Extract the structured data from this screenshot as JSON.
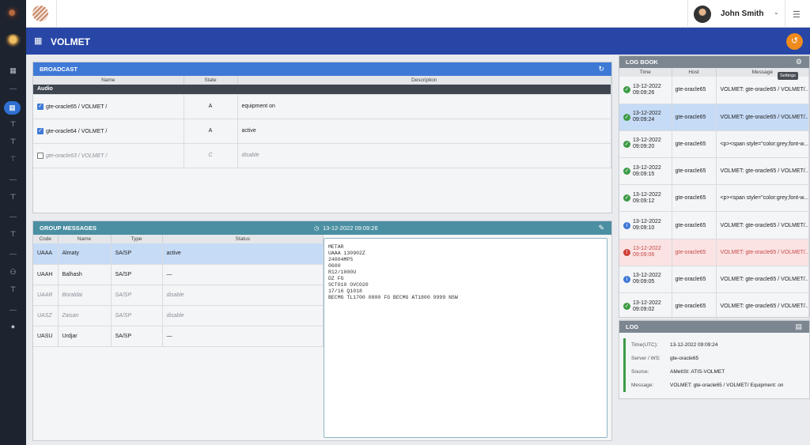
{
  "topbar": {
    "user_name": "John Smith"
  },
  "page": {
    "title": "VOLMET"
  },
  "broadcast": {
    "title": "BROADCAST",
    "columns": [
      "Name",
      "State",
      "Description"
    ],
    "group": "Audio",
    "rows": [
      {
        "name": "gte-oracle65 / VOLMET /",
        "state": "A",
        "description": "equipment on",
        "checked": true
      },
      {
        "name": "gte-oracle64 / VOLMET /",
        "state": "A",
        "description": "active",
        "checked": true
      },
      {
        "name": "gte-oracle63 / VOLMET /",
        "state": "C",
        "description": "disable",
        "checked": false
      }
    ]
  },
  "group_messages": {
    "title": "GROUP MESSAGES",
    "timestamp": "13-12-2022 09:09:26",
    "columns": [
      "Code",
      "Name",
      "Type",
      "Status"
    ],
    "rows": [
      {
        "code": "UAAA",
        "name": "Almaty",
        "type": "SA/SP",
        "status": "active"
      },
      {
        "code": "UAAH",
        "name": "Balhash",
        "type": "SA/SP",
        "status": "—"
      },
      {
        "code": "UAAR",
        "name": "Boraldai",
        "type": "SA/SP",
        "status": "disable"
      },
      {
        "code": "UASZ",
        "name": "Zaisan",
        "type": "SA/SP",
        "status": "disable"
      },
      {
        "code": "UASU",
        "name": "Urdjar",
        "type": "SA/SP",
        "status": "—"
      }
    ],
    "metar_text": "METAR\nUAAA 130902Z\n24004MPS\n0600\nR12/1000U\nDZ FG\nSCT010 OVC020\n17/16 Q1018\nBECMG TL1700 0800 FG BECMG AT1800 9999 NSW"
  },
  "log_book": {
    "title": "LOG BOOK",
    "columns": [
      "Time",
      "Host",
      "Message"
    ],
    "tooltip": "Settings",
    "rows": [
      {
        "status": "ok",
        "date": "13-12-2022",
        "time": "09:09:26",
        "host": "gte-oracle65",
        "message": "VOLMET: gte-oracle65 / VOLMET/..."
      },
      {
        "status": "ok",
        "date": "13-12-2022",
        "time": "09:09:24",
        "host": "gte-oracle65",
        "message": "VOLMET: gte-oracle65 / VOLMET/..."
      },
      {
        "status": "ok",
        "date": "13-12-2022",
        "time": "09:09:20",
        "host": "gte-oracle65",
        "message": "<p><span style=\"color:grey;font-w..."
      },
      {
        "status": "ok",
        "date": "13-12-2022",
        "time": "09:09:15",
        "host": "gte-oracle65",
        "message": "VOLMET: gte-oracle65 / VOLMET/..."
      },
      {
        "status": "ok",
        "date": "13-12-2022",
        "time": "09:09:12",
        "host": "gte-oracle65",
        "message": "<p><span style=\"color:grey;font-w..."
      },
      {
        "status": "info",
        "date": "13-12-2022",
        "time": "09:09:10",
        "host": "gte-oracle65",
        "message": "VOLMET: gte-oracle65 / VOLMET/..."
      },
      {
        "status": "err",
        "date": "13-12-2022",
        "time": "09:09:06",
        "host": "gte-oracle65",
        "message": "VOLMET: gte-oracle65 / VOLMET/..."
      },
      {
        "status": "info",
        "date": "13-12-2022",
        "time": "09:09:05",
        "host": "gte-oracle65",
        "message": "VOLMET: gte-oracle65 / VOLMET/..."
      },
      {
        "status": "ok",
        "date": "13-12-2022",
        "time": "09:09:02",
        "host": "gte-oracle65",
        "message": "VOLMET: gte-oracle65 / VOLMET/..."
      }
    ]
  },
  "log": {
    "title": "LOG",
    "fields": [
      {
        "label": "Time(UTC):",
        "value": "13-12-2022 09:09:24"
      },
      {
        "label": "Server / WS:",
        "value": "gte-oracle65"
      },
      {
        "label": "Source:",
        "value": "AMetISt: ATIS-VOLMET"
      },
      {
        "label": "Message:",
        "value": "VOLMET: gte-oracle65 / VOLMET/ Equipment: on"
      }
    ]
  },
  "colors": {
    "accent": "#2746a6",
    "panel_blue": "#3f79d6",
    "panel_teal": "#4b8fa2",
    "warning": "#ef8a1c"
  },
  "icons": [
    "app-logo-icon",
    "dashboard-icon",
    "antenna-icon",
    "group-icon",
    "user-icon",
    "history-icon",
    "refresh-icon",
    "edit-icon",
    "clock-icon",
    "gear-icon",
    "menu-icon"
  ]
}
